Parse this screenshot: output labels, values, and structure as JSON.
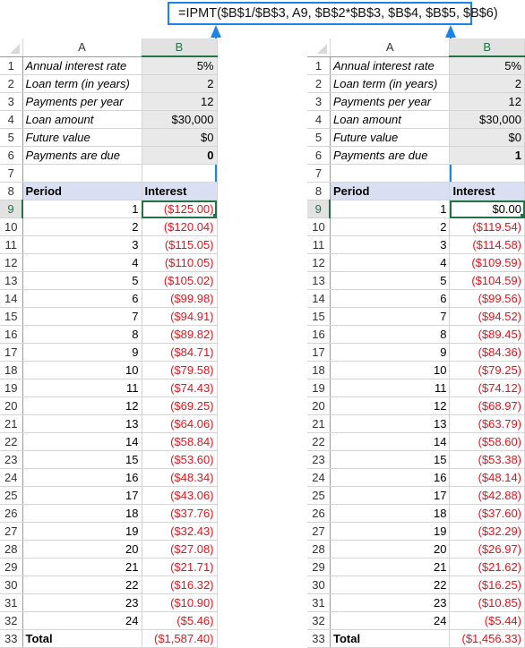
{
  "formula": "=IPMT($B$1/$B$3, A9, $B$2*$B$3, $B$4, $B$5, $B$6)",
  "sheets": [
    {
      "columns": [
        "A",
        "B"
      ],
      "params": [
        {
          "row": "1",
          "label": "Annual interest rate",
          "value": "5%"
        },
        {
          "row": "2",
          "label": "Loan term (in years)",
          "value": "2"
        },
        {
          "row": "3",
          "label": "Payments per year",
          "value": "12"
        },
        {
          "row": "4",
          "label": "Loan amount",
          "value": "$30,000"
        },
        {
          "row": "5",
          "label": "Future value",
          "value": "$0"
        },
        {
          "row": "6",
          "label": "Payments are due",
          "value": "0"
        }
      ],
      "row7": "7",
      "header": {
        "row": "8",
        "period": "Period",
        "interest": "Interest"
      },
      "rows": [
        {
          "row": "9",
          "period": "1",
          "interest": "($125.00)"
        },
        {
          "row": "10",
          "period": "2",
          "interest": "($120.04)"
        },
        {
          "row": "11",
          "period": "3",
          "interest": "($115.05)"
        },
        {
          "row": "12",
          "period": "4",
          "interest": "($110.05)"
        },
        {
          "row": "13",
          "period": "5",
          "interest": "($105.02)"
        },
        {
          "row": "14",
          "period": "6",
          "interest": "($99.98)"
        },
        {
          "row": "15",
          "period": "7",
          "interest": "($94.91)"
        },
        {
          "row": "16",
          "period": "8",
          "interest": "($89.82)"
        },
        {
          "row": "17",
          "period": "9",
          "interest": "($84.71)"
        },
        {
          "row": "18",
          "period": "10",
          "interest": "($79.58)"
        },
        {
          "row": "19",
          "period": "11",
          "interest": "($74.43)"
        },
        {
          "row": "20",
          "period": "12",
          "interest": "($69.25)"
        },
        {
          "row": "21",
          "period": "13",
          "interest": "($64.06)"
        },
        {
          "row": "22",
          "period": "14",
          "interest": "($58.84)"
        },
        {
          "row": "23",
          "period": "15",
          "interest": "($53.60)"
        },
        {
          "row": "24",
          "period": "16",
          "interest": "($48.34)"
        },
        {
          "row": "25",
          "period": "17",
          "interest": "($43.06)"
        },
        {
          "row": "26",
          "period": "18",
          "interest": "($37.76)"
        },
        {
          "row": "27",
          "period": "19",
          "interest": "($32.43)"
        },
        {
          "row": "28",
          "period": "20",
          "interest": "($27.08)"
        },
        {
          "row": "29",
          "period": "21",
          "interest": "($21.71)"
        },
        {
          "row": "30",
          "period": "22",
          "interest": "($16.32)"
        },
        {
          "row": "31",
          "period": "23",
          "interest": "($10.90)"
        },
        {
          "row": "32",
          "period": "24",
          "interest": "($5.46)"
        }
      ],
      "total": {
        "row": "33",
        "label": "Total",
        "value": "($1,587.40)"
      }
    },
    {
      "columns": [
        "A",
        "B"
      ],
      "params": [
        {
          "row": "1",
          "label": "Annual interest rate",
          "value": "5%"
        },
        {
          "row": "2",
          "label": "Loan term (in years)",
          "value": "2"
        },
        {
          "row": "3",
          "label": "Payments per year",
          "value": "12"
        },
        {
          "row": "4",
          "label": "Loan amount",
          "value": "$30,000"
        },
        {
          "row": "5",
          "label": "Future value",
          "value": "$0"
        },
        {
          "row": "6",
          "label": "Payments are due",
          "value": "1"
        }
      ],
      "row7": "7",
      "header": {
        "row": "8",
        "period": "Period",
        "interest": "Interest"
      },
      "rows": [
        {
          "row": "9",
          "period": "1",
          "interest": "$0.00"
        },
        {
          "row": "10",
          "period": "2",
          "interest": "($119.54)"
        },
        {
          "row": "11",
          "period": "3",
          "interest": "($114.58)"
        },
        {
          "row": "12",
          "period": "4",
          "interest": "($109.59)"
        },
        {
          "row": "13",
          "period": "5",
          "interest": "($104.59)"
        },
        {
          "row": "14",
          "period": "6",
          "interest": "($99.56)"
        },
        {
          "row": "15",
          "period": "7",
          "interest": "($94.52)"
        },
        {
          "row": "16",
          "period": "8",
          "interest": "($89.45)"
        },
        {
          "row": "17",
          "period": "9",
          "interest": "($84.36)"
        },
        {
          "row": "18",
          "period": "10",
          "interest": "($79.25)"
        },
        {
          "row": "19",
          "period": "11",
          "interest": "($74.12)"
        },
        {
          "row": "20",
          "period": "12",
          "interest": "($68.97)"
        },
        {
          "row": "21",
          "period": "13",
          "interest": "($63.79)"
        },
        {
          "row": "22",
          "period": "14",
          "interest": "($58.60)"
        },
        {
          "row": "23",
          "period": "15",
          "interest": "($53.38)"
        },
        {
          "row": "24",
          "period": "16",
          "interest": "($48.14)"
        },
        {
          "row": "25",
          "period": "17",
          "interest": "($42.88)"
        },
        {
          "row": "26",
          "period": "18",
          "interest": "($37.60)"
        },
        {
          "row": "27",
          "period": "19",
          "interest": "($32.29)"
        },
        {
          "row": "28",
          "period": "20",
          "interest": "($26.97)"
        },
        {
          "row": "29",
          "period": "21",
          "interest": "($21.62)"
        },
        {
          "row": "30",
          "period": "22",
          "interest": "($16.25)"
        },
        {
          "row": "31",
          "period": "23",
          "interest": "($10.85)"
        },
        {
          "row": "32",
          "period": "24",
          "interest": "($5.44)"
        }
      ],
      "total": {
        "row": "33",
        "label": "Total",
        "value": "($1,456.33)"
      }
    }
  ],
  "colors": {
    "negative": "#e8121b",
    "accent_green": "#217346",
    "callout_blue": "#1a85e8",
    "header_fill": "#dae0f1"
  }
}
